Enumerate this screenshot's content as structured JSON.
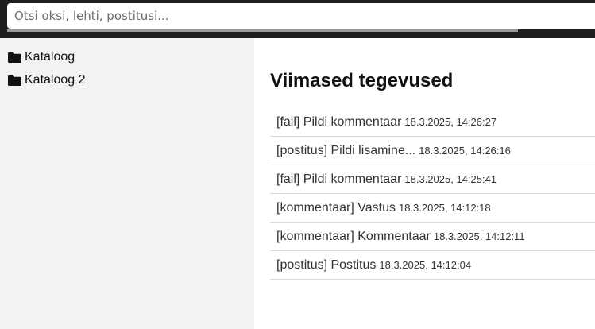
{
  "search": {
    "placeholder": "Otsi oksi, lehti, postitusi..."
  },
  "sidebar": {
    "items": [
      {
        "label": "Kataloog",
        "icon": "folder-icon"
      },
      {
        "label": "Kataloog 2",
        "icon": "folder-icon"
      }
    ]
  },
  "main": {
    "title": "Viimased tegevused",
    "activities": [
      {
        "label": "[fail] Pildi kommentaar",
        "time": "18.3.2025, 14:26:27"
      },
      {
        "label": "[postitus] Pildi lisamine...",
        "time": "18.3.2025, 14:26:16"
      },
      {
        "label": "[fail] Pildi kommentaar",
        "time": "18.3.2025, 14:25:41"
      },
      {
        "label": "[kommentaar] Vastus",
        "time": "18.3.2025, 14:12:18"
      },
      {
        "label": "[kommentaar] Kommentaar",
        "time": "18.3.2025, 14:12:11"
      },
      {
        "label": "[postitus] Postitus",
        "time": "18.3.2025, 14:12:04"
      }
    ]
  },
  "colors": {
    "topbar": "#1f1f1f",
    "sidebar": "#f2f2f2",
    "text": "#111111"
  }
}
